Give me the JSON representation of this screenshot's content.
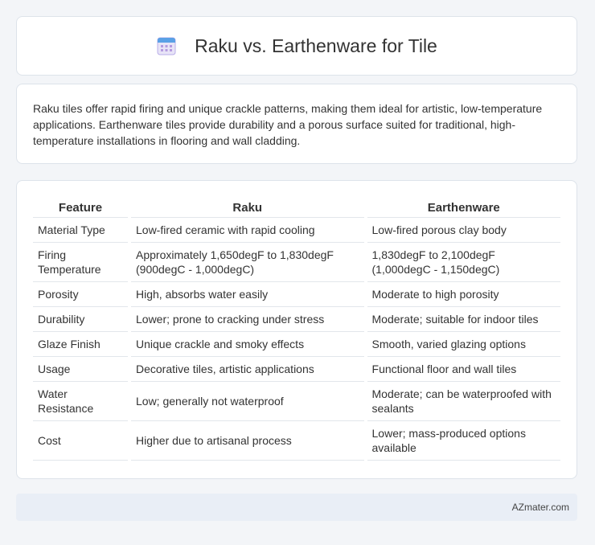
{
  "header": {
    "title": "Raku vs. Earthenware for Tile",
    "icon": "calendar-icon"
  },
  "intro": {
    "text": "Raku tiles offer rapid firing and unique crackle patterns, making them ideal for artistic, low-temperature applications. Earthenware tiles provide durability and a porous surface suited for traditional, high-temperature installations in flooring and wall cladding."
  },
  "table": {
    "headers": [
      "Feature",
      "Raku",
      "Earthenware"
    ],
    "rows": [
      [
        "Material Type",
        "Low-fired ceramic with rapid cooling",
        "Low-fired porous clay body"
      ],
      [
        "Firing Temperature",
        "Approximately 1,650degF to 1,830degF (900degC - 1,000degC)",
        "1,830degF to 2,100degF (1,000degC - 1,150degC)"
      ],
      [
        "Porosity",
        "High, absorbs water easily",
        "Moderate to high porosity"
      ],
      [
        "Durability",
        "Lower; prone to cracking under stress",
        "Moderate; suitable for indoor tiles"
      ],
      [
        "Glaze Finish",
        "Unique crackle and smoky effects",
        "Smooth, varied glazing options"
      ],
      [
        "Usage",
        "Decorative tiles, artistic applications",
        "Functional floor and wall tiles"
      ],
      [
        "Water Resistance",
        "Low; generally not waterproof",
        "Moderate; can be waterproofed with sealants"
      ],
      [
        "Cost",
        "Higher due to artisanal process",
        "Lower; mass-produced options available"
      ]
    ]
  },
  "footer": {
    "brand": "AZmater.com"
  }
}
